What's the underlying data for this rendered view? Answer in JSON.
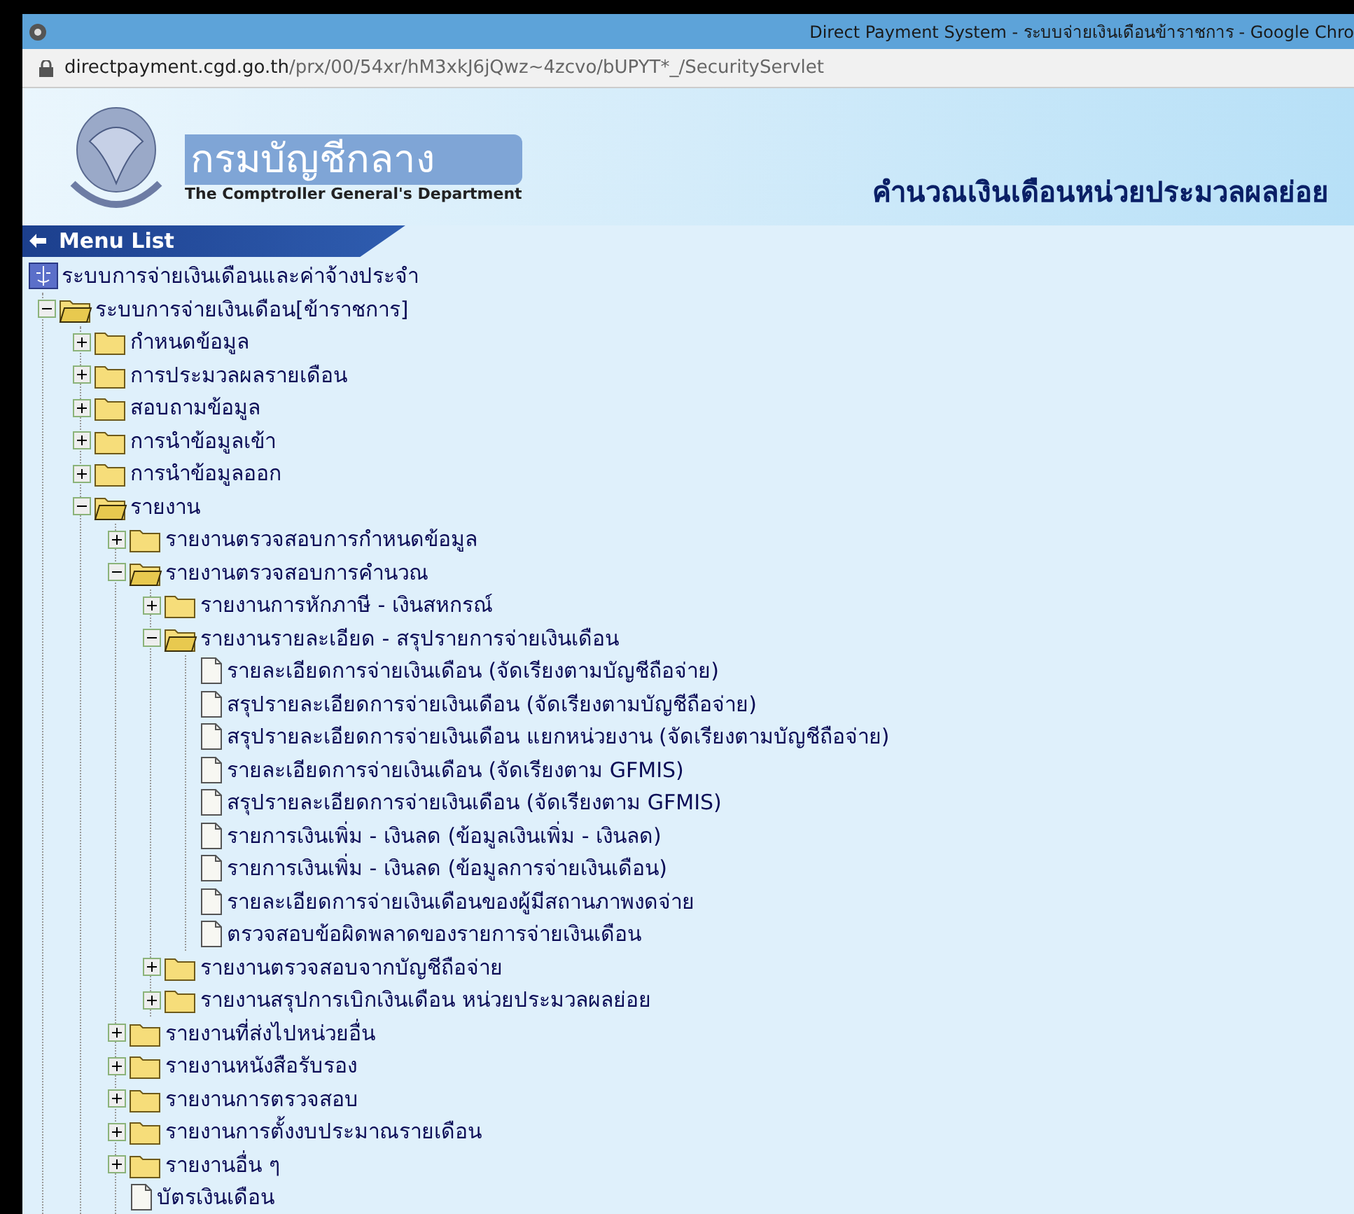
{
  "window": {
    "title": "Direct Payment System - ระบบจ่ายเงินเดือนข้าราชการ - Google Chro"
  },
  "address_bar": {
    "domain": "directpayment.cgd.go.th",
    "path": "/prx/00/54xr/hM3xkJ6jQwz~4zcvo/bUPYT*_/SecurityServlet"
  },
  "header": {
    "org_name": "กรมบัญชีกลาง",
    "org_name_en": "The Comptroller General's Department",
    "page_title": "คำนวณเงินเดือนหน่วยประมวลผลย่อย"
  },
  "menu": {
    "title": "Menu List",
    "tree": [
      {
        "kind": "system",
        "label": "ระบบการจ่ายเงินเดือนและค่าจ้างประจำ",
        "children": [
          {
            "kind": "folder",
            "label": "ระบบการจ่ายเงินเดือน[ข้าราชการ]",
            "expanded": true,
            "children": [
              {
                "kind": "folder",
                "label": "กำหนดข้อมูล",
                "expanded": false
              },
              {
                "kind": "folder",
                "label": "การประมวลผลรายเดือน",
                "expanded": false
              },
              {
                "kind": "folder",
                "label": "สอบถามข้อมูล",
                "expanded": false
              },
              {
                "kind": "folder",
                "label": "การนำข้อมูลเข้า",
                "expanded": false
              },
              {
                "kind": "folder",
                "label": "การนำข้อมูลออก",
                "expanded": false
              },
              {
                "kind": "folder",
                "label": "รายงาน",
                "expanded": true,
                "children": [
                  {
                    "kind": "folder",
                    "label": "รายงานตรวจสอบการกำหนดข้อมูล",
                    "expanded": false
                  },
                  {
                    "kind": "folder",
                    "label": "รายงานตรวจสอบการคำนวณ",
                    "expanded": true,
                    "children": [
                      {
                        "kind": "folder",
                        "label": "รายงานการหักภาษี - เงินสหกรณ์",
                        "expanded": false
                      },
                      {
                        "kind": "folder",
                        "label": "รายงานรายละเอียด - สรุปรายการจ่ายเงินเดือน",
                        "expanded": true,
                        "children": [
                          {
                            "kind": "doc",
                            "label": "รายละเอียดการจ่ายเงินเดือน (จัดเรียงตามบัญชีถือจ่าย)"
                          },
                          {
                            "kind": "doc",
                            "label": "สรุปรายละเอียดการจ่ายเงินเดือน (จัดเรียงตามบัญชีถือจ่าย)"
                          },
                          {
                            "kind": "doc",
                            "label": "สรุปรายละเอียดการจ่ายเงินเดือน แยกหน่วยงาน (จัดเรียงตามบัญชีถือจ่าย)"
                          },
                          {
                            "kind": "doc",
                            "label": "รายละเอียดการจ่ายเงินเดือน (จัดเรียงตาม GFMIS)"
                          },
                          {
                            "kind": "doc",
                            "label": "สรุปรายละเอียดการจ่ายเงินเดือน (จัดเรียงตาม GFMIS)"
                          },
                          {
                            "kind": "doc",
                            "label": "รายการเงินเพิ่ม - เงินลด (ข้อมูลเงินเพิ่ม - เงินลด)"
                          },
                          {
                            "kind": "doc",
                            "label": "รายการเงินเพิ่ม - เงินลด (ข้อมูลการจ่ายเงินเดือน)"
                          },
                          {
                            "kind": "doc",
                            "label": "รายละเอียดการจ่ายเงินเดือนของผู้มีสถานภาพงดจ่าย"
                          },
                          {
                            "kind": "doc",
                            "label": "ตรวจสอบข้อผิดพลาดของรายการจ่ายเงินเดือน"
                          }
                        ]
                      },
                      {
                        "kind": "folder",
                        "label": "รายงานตรวจสอบจากบัญชีถือจ่าย",
                        "expanded": false
                      },
                      {
                        "kind": "folder",
                        "label": "รายงานสรุปการเบิกเงินเดือน หน่วยประมวลผลย่อย",
                        "expanded": false
                      }
                    ]
                  },
                  {
                    "kind": "folder",
                    "label": "รายงานที่ส่งไปหน่วยอื่น",
                    "expanded": false
                  },
                  {
                    "kind": "folder",
                    "label": "รายงานหนังสือรับรอง",
                    "expanded": false
                  },
                  {
                    "kind": "folder",
                    "label": "รายงานการตรวจสอบ",
                    "expanded": false
                  },
                  {
                    "kind": "folder",
                    "label": "รายงานการตั้งงบประมาณรายเดือน",
                    "expanded": false
                  },
                  {
                    "kind": "folder",
                    "label": "รายงานอื่น ๆ",
                    "expanded": false
                  },
                  {
                    "kind": "doc",
                    "label": "บัตรเงินเดือน"
                  }
                ]
              }
            ]
          }
        ]
      }
    ]
  }
}
